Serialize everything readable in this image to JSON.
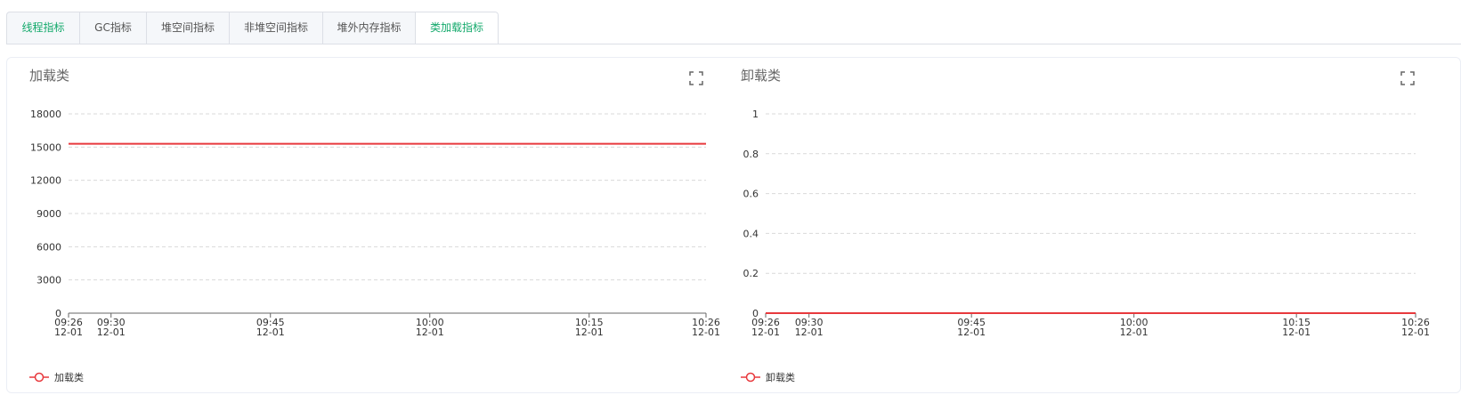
{
  "tabs": [
    {
      "label": "线程指标",
      "state": "highlight"
    },
    {
      "label": "GC指标",
      "state": "normal"
    },
    {
      "label": "堆空间指标",
      "state": "normal"
    },
    {
      "label": "非堆空间指标",
      "state": "normal"
    },
    {
      "label": "堆外内存指标",
      "state": "normal"
    },
    {
      "label": "类加载指标",
      "state": "active"
    }
  ],
  "colors": {
    "accent": "#13a96b",
    "series": "#e8393d",
    "grid": "#d9d9d9",
    "axis": "#666666"
  },
  "chart_data": [
    {
      "type": "line",
      "title": "加载类",
      "x_ticks": [
        {
          "time": "09:26",
          "date": "12-01"
        },
        {
          "time": "09:30",
          "date": "12-01"
        },
        {
          "time": "09:45",
          "date": "12-01"
        },
        {
          "time": "10:00",
          "date": "12-01"
        },
        {
          "time": "10:15",
          "date": "12-01"
        },
        {
          "time": "10:26",
          "date": "12-01"
        }
      ],
      "y_ticks": [
        "0",
        "3000",
        "6000",
        "9000",
        "12000",
        "15000",
        "18000"
      ],
      "ylim": [
        0,
        18000
      ],
      "grid": true,
      "series": [
        {
          "name": "加载类",
          "x": [
            "09:26",
            "10:26"
          ],
          "values": [
            15300,
            15300
          ]
        }
      ],
      "legend": "bottom-left"
    },
    {
      "type": "line",
      "title": "卸载类",
      "x_ticks": [
        {
          "time": "09:26",
          "date": "12-01"
        },
        {
          "time": "09:30",
          "date": "12-01"
        },
        {
          "time": "09:45",
          "date": "12-01"
        },
        {
          "time": "10:00",
          "date": "12-01"
        },
        {
          "time": "10:15",
          "date": "12-01"
        },
        {
          "time": "10:26",
          "date": "12-01"
        }
      ],
      "y_ticks": [
        "0",
        "0.2",
        "0.4",
        "0.6",
        "0.8",
        "1"
      ],
      "ylim": [
        0,
        1
      ],
      "grid": true,
      "series": [
        {
          "name": "卸载类",
          "x": [
            "09:26",
            "10:26"
          ],
          "values": [
            0,
            0
          ]
        }
      ],
      "legend": "bottom-left"
    }
  ]
}
